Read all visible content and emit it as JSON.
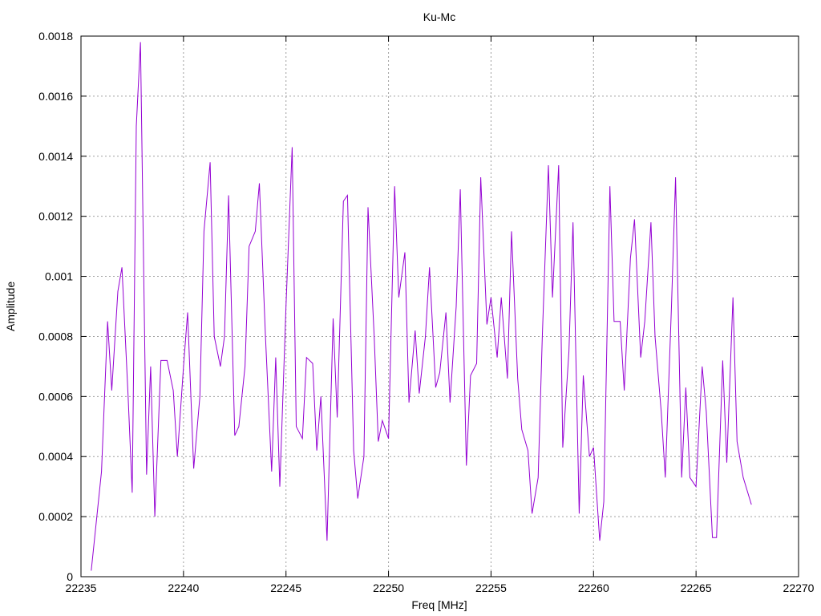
{
  "chart_data": {
    "type": "line",
    "title": "Ku-Mc",
    "xlabel": "Freq [MHz]",
    "ylabel": "Amplitude",
    "xlim": [
      22235,
      22270
    ],
    "ylim": [
      0,
      0.0018
    ],
    "xticks": [
      "22235",
      "22240",
      "22245",
      "22250",
      "22255",
      "22260",
      "22265",
      "22270"
    ],
    "yticks": [
      "0",
      "0.0002",
      "0.0004",
      "0.0006",
      "0.0008",
      "0.001",
      "0.0012",
      "0.0014",
      "0.0016",
      "0.0018"
    ],
    "grid": true,
    "line_color": "#9400d3",
    "series": [
      {
        "points": [
          [
            22235.5,
            2e-05
          ],
          [
            22236.0,
            0.00035
          ],
          [
            22236.3,
            0.00085
          ],
          [
            22236.5,
            0.00062
          ],
          [
            22236.8,
            0.00095
          ],
          [
            22237.0,
            0.00103
          ],
          [
            22237.3,
            0.0006
          ],
          [
            22237.5,
            0.00028
          ],
          [
            22237.7,
            0.0015
          ],
          [
            22237.9,
            0.00178
          ],
          [
            22238.2,
            0.00034
          ],
          [
            22238.4,
            0.0007
          ],
          [
            22238.6,
            0.0002
          ],
          [
            22238.9,
            0.00072
          ],
          [
            22239.2,
            0.00072
          ],
          [
            22239.5,
            0.00062
          ],
          [
            22239.7,
            0.0004
          ],
          [
            22240.0,
            0.0007
          ],
          [
            22240.2,
            0.00088
          ],
          [
            22240.5,
            0.00036
          ],
          [
            22240.8,
            0.0006
          ],
          [
            22241.0,
            0.00115
          ],
          [
            22241.3,
            0.00138
          ],
          [
            22241.5,
            0.0008
          ],
          [
            22241.8,
            0.0007
          ],
          [
            22242.0,
            0.0008
          ],
          [
            22242.2,
            0.00127
          ],
          [
            22242.5,
            0.00047
          ],
          [
            22242.7,
            0.0005
          ],
          [
            22243.0,
            0.0007
          ],
          [
            22243.2,
            0.0011
          ],
          [
            22243.5,
            0.00115
          ],
          [
            22243.7,
            0.00131
          ],
          [
            22244.0,
            0.0008
          ],
          [
            22244.3,
            0.00035
          ],
          [
            22244.5,
            0.00073
          ],
          [
            22244.7,
            0.0003
          ],
          [
            22245.0,
            0.0009
          ],
          [
            22245.3,
            0.00143
          ],
          [
            22245.5,
            0.0005
          ],
          [
            22245.8,
            0.00046
          ],
          [
            22246.0,
            0.00073
          ],
          [
            22246.3,
            0.00071
          ],
          [
            22246.5,
            0.00042
          ],
          [
            22246.7,
            0.0006
          ],
          [
            22247.0,
            0.00012
          ],
          [
            22247.3,
            0.00086
          ],
          [
            22247.5,
            0.00053
          ],
          [
            22247.8,
            0.00125
          ],
          [
            22248.0,
            0.00127
          ],
          [
            22248.3,
            0.00042
          ],
          [
            22248.5,
            0.00026
          ],
          [
            22248.8,
            0.0004
          ],
          [
            22249.0,
            0.00123
          ],
          [
            22249.3,
            0.0008
          ],
          [
            22249.5,
            0.00045
          ],
          [
            22249.7,
            0.00052
          ],
          [
            22250.0,
            0.00046
          ],
          [
            22250.3,
            0.0013
          ],
          [
            22250.5,
            0.00093
          ],
          [
            22250.8,
            0.00108
          ],
          [
            22251.0,
            0.00058
          ],
          [
            22251.3,
            0.00082
          ],
          [
            22251.5,
            0.00061
          ],
          [
            22251.8,
            0.0008
          ],
          [
            22252.0,
            0.00103
          ],
          [
            22252.3,
            0.00063
          ],
          [
            22252.5,
            0.00068
          ],
          [
            22252.8,
            0.00088
          ],
          [
            22253.0,
            0.00058
          ],
          [
            22253.3,
            0.0009
          ],
          [
            22253.5,
            0.00129
          ],
          [
            22253.8,
            0.00037
          ],
          [
            22254.0,
            0.00067
          ],
          [
            22254.3,
            0.00071
          ],
          [
            22254.5,
            0.00133
          ],
          [
            22254.8,
            0.00084
          ],
          [
            22255.0,
            0.00093
          ],
          [
            22255.3,
            0.00073
          ],
          [
            22255.5,
            0.00093
          ],
          [
            22255.8,
            0.00066
          ],
          [
            22256.0,
            0.00115
          ],
          [
            22256.3,
            0.00066
          ],
          [
            22256.5,
            0.00049
          ],
          [
            22256.8,
            0.00042
          ],
          [
            22257.0,
            0.00021
          ],
          [
            22257.3,
            0.00033
          ],
          [
            22257.5,
            0.0008
          ],
          [
            22257.8,
            0.00137
          ],
          [
            22258.0,
            0.00093
          ],
          [
            22258.3,
            0.00137
          ],
          [
            22258.5,
            0.00043
          ],
          [
            22258.8,
            0.00075
          ],
          [
            22259.0,
            0.00118
          ],
          [
            22259.3,
            0.00021
          ],
          [
            22259.5,
            0.00067
          ],
          [
            22259.8,
            0.0004
          ],
          [
            22260.0,
            0.00043
          ],
          [
            22260.3,
            0.00012
          ],
          [
            22260.5,
            0.00025
          ],
          [
            22260.8,
            0.0013
          ],
          [
            22261.0,
            0.00085
          ],
          [
            22261.3,
            0.00085
          ],
          [
            22261.5,
            0.00062
          ],
          [
            22261.8,
            0.00106
          ],
          [
            22262.0,
            0.00119
          ],
          [
            22262.3,
            0.00073
          ],
          [
            22262.5,
            0.00085
          ],
          [
            22262.8,
            0.00118
          ],
          [
            22263.0,
            0.0008
          ],
          [
            22263.3,
            0.00055
          ],
          [
            22263.5,
            0.00033
          ],
          [
            22263.8,
            0.0009
          ],
          [
            22264.0,
            0.00133
          ],
          [
            22264.3,
            0.00033
          ],
          [
            22264.5,
            0.00063
          ],
          [
            22264.7,
            0.00033
          ],
          [
            22265.0,
            0.0003
          ],
          [
            22265.3,
            0.0007
          ],
          [
            22265.5,
            0.00055
          ],
          [
            22265.8,
            0.00013
          ],
          [
            22266.0,
            0.00013
          ],
          [
            22266.3,
            0.00072
          ],
          [
            22266.5,
            0.00038
          ],
          [
            22266.8,
            0.00093
          ],
          [
            22267.0,
            0.00045
          ],
          [
            22267.3,
            0.00033
          ],
          [
            22267.7,
            0.00024
          ]
        ]
      }
    ]
  }
}
